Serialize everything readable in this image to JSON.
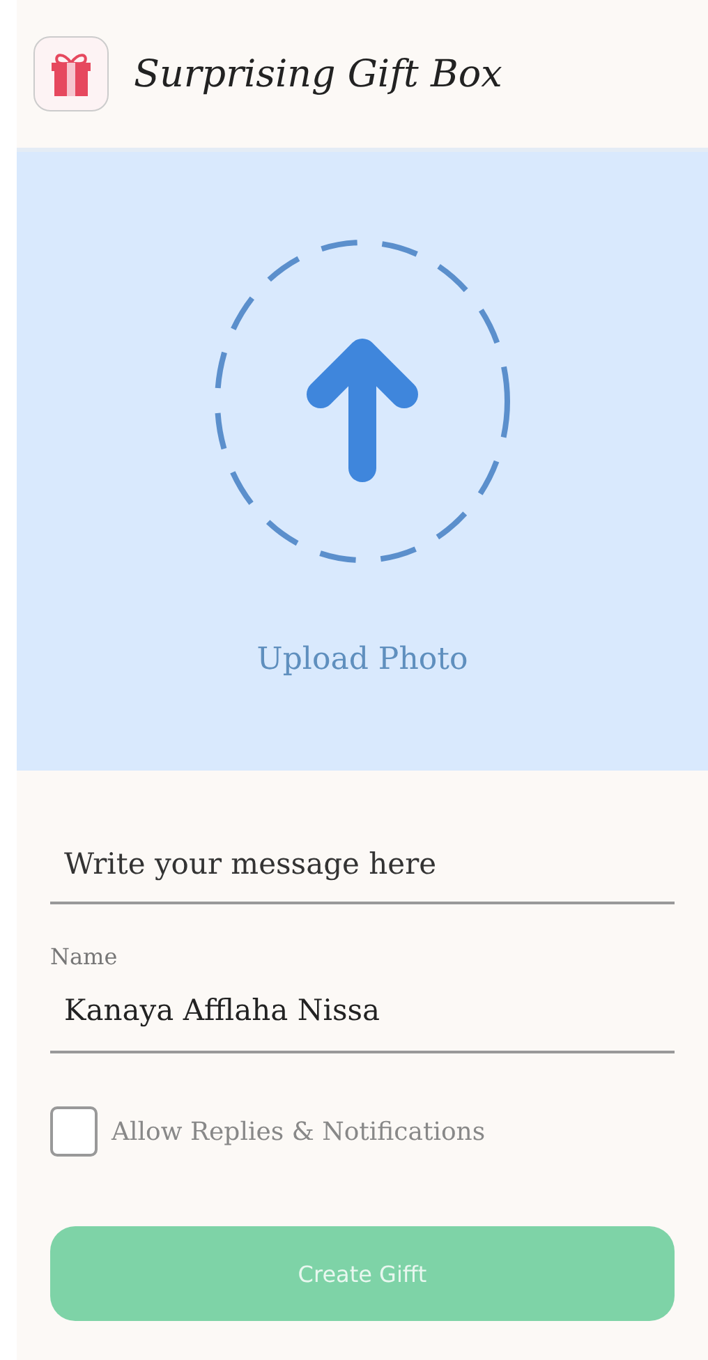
{
  "app_bar": {
    "title": "Surprising Gift Box"
  },
  "upload": {
    "label": "Upload Photo"
  },
  "message_field": {
    "placeholder": "Write your message here"
  },
  "name_field": {
    "label": "Name",
    "value": "Kanaya Afflaha Nissa"
  },
  "allow_replies": {
    "label": "Allow Replies & Notifications",
    "checked": false
  },
  "create_button": {
    "label": "Create Gifft",
    "disabled": true
  }
}
